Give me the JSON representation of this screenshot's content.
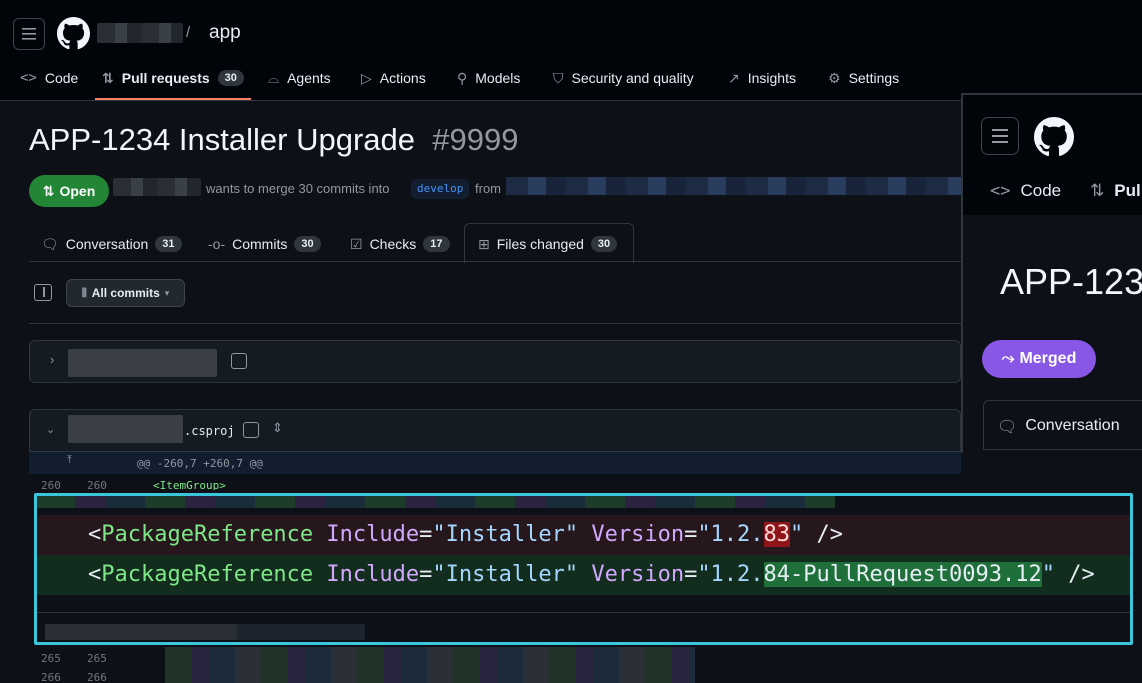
{
  "header": {
    "repo_name": "app",
    "slash": "/",
    "nav": [
      {
        "label": "Code",
        "icon": "code-icon"
      },
      {
        "label": "Pull requests",
        "count": "30",
        "icon": "pull-request-icon"
      },
      {
        "label": "Agents",
        "icon": "agents-icon"
      },
      {
        "label": "Actions",
        "icon": "play-icon"
      },
      {
        "label": "Models",
        "icon": "models-icon"
      },
      {
        "label": "Security and quality",
        "icon": "shield-icon"
      },
      {
        "label": "Insights",
        "icon": "graph-icon"
      },
      {
        "label": "Settings",
        "icon": "gear-icon"
      }
    ]
  },
  "pr": {
    "title": "APP-1234 Installer Upgrade",
    "number": "#9999",
    "state": "Open",
    "merge_text": "wants to merge 30 commits into",
    "base_branch": "develop",
    "from_text": "from"
  },
  "tabs": [
    {
      "label": "Conversation",
      "count": "31"
    },
    {
      "label": "Commits",
      "count": "30"
    },
    {
      "label": "Checks",
      "count": "17"
    },
    {
      "label": "Files changed",
      "count": "30"
    }
  ],
  "toolbar": {
    "commits_filter": "All commits"
  },
  "files": {
    "file2_suffix": ".csproj",
    "hunk_header": "@@ -260,7 +260,7 @@",
    "line_260_old": "260",
    "line_260_new": "260",
    "line_260_code": "<ItemGroup>",
    "line_265_old": "265",
    "line_265_new": "265",
    "line_266_old": "266",
    "line_266_new": "266"
  },
  "diff": {
    "tag": "PackageReference",
    "attr_include": "Include",
    "include_value": "\"Installer\"",
    "attr_version": "Version",
    "removed_prefix": "\"1.2.",
    "removed_changed": "83",
    "removed_suffix": "\"",
    "added_prefix": "\"1.2.",
    "added_changed": "84-PullRequest0093.12",
    "added_suffix": "\"",
    "close": "/>"
  },
  "overlay": {
    "nav_code": "Code",
    "nav_pull_partial": "Pul",
    "title_partial": "APP-123",
    "state": "Merged",
    "tab": "Conversation"
  },
  "colors": {
    "open_green": "#238636",
    "merged_purple": "#8957e5",
    "highlight_frame": "#3bc6dc"
  }
}
